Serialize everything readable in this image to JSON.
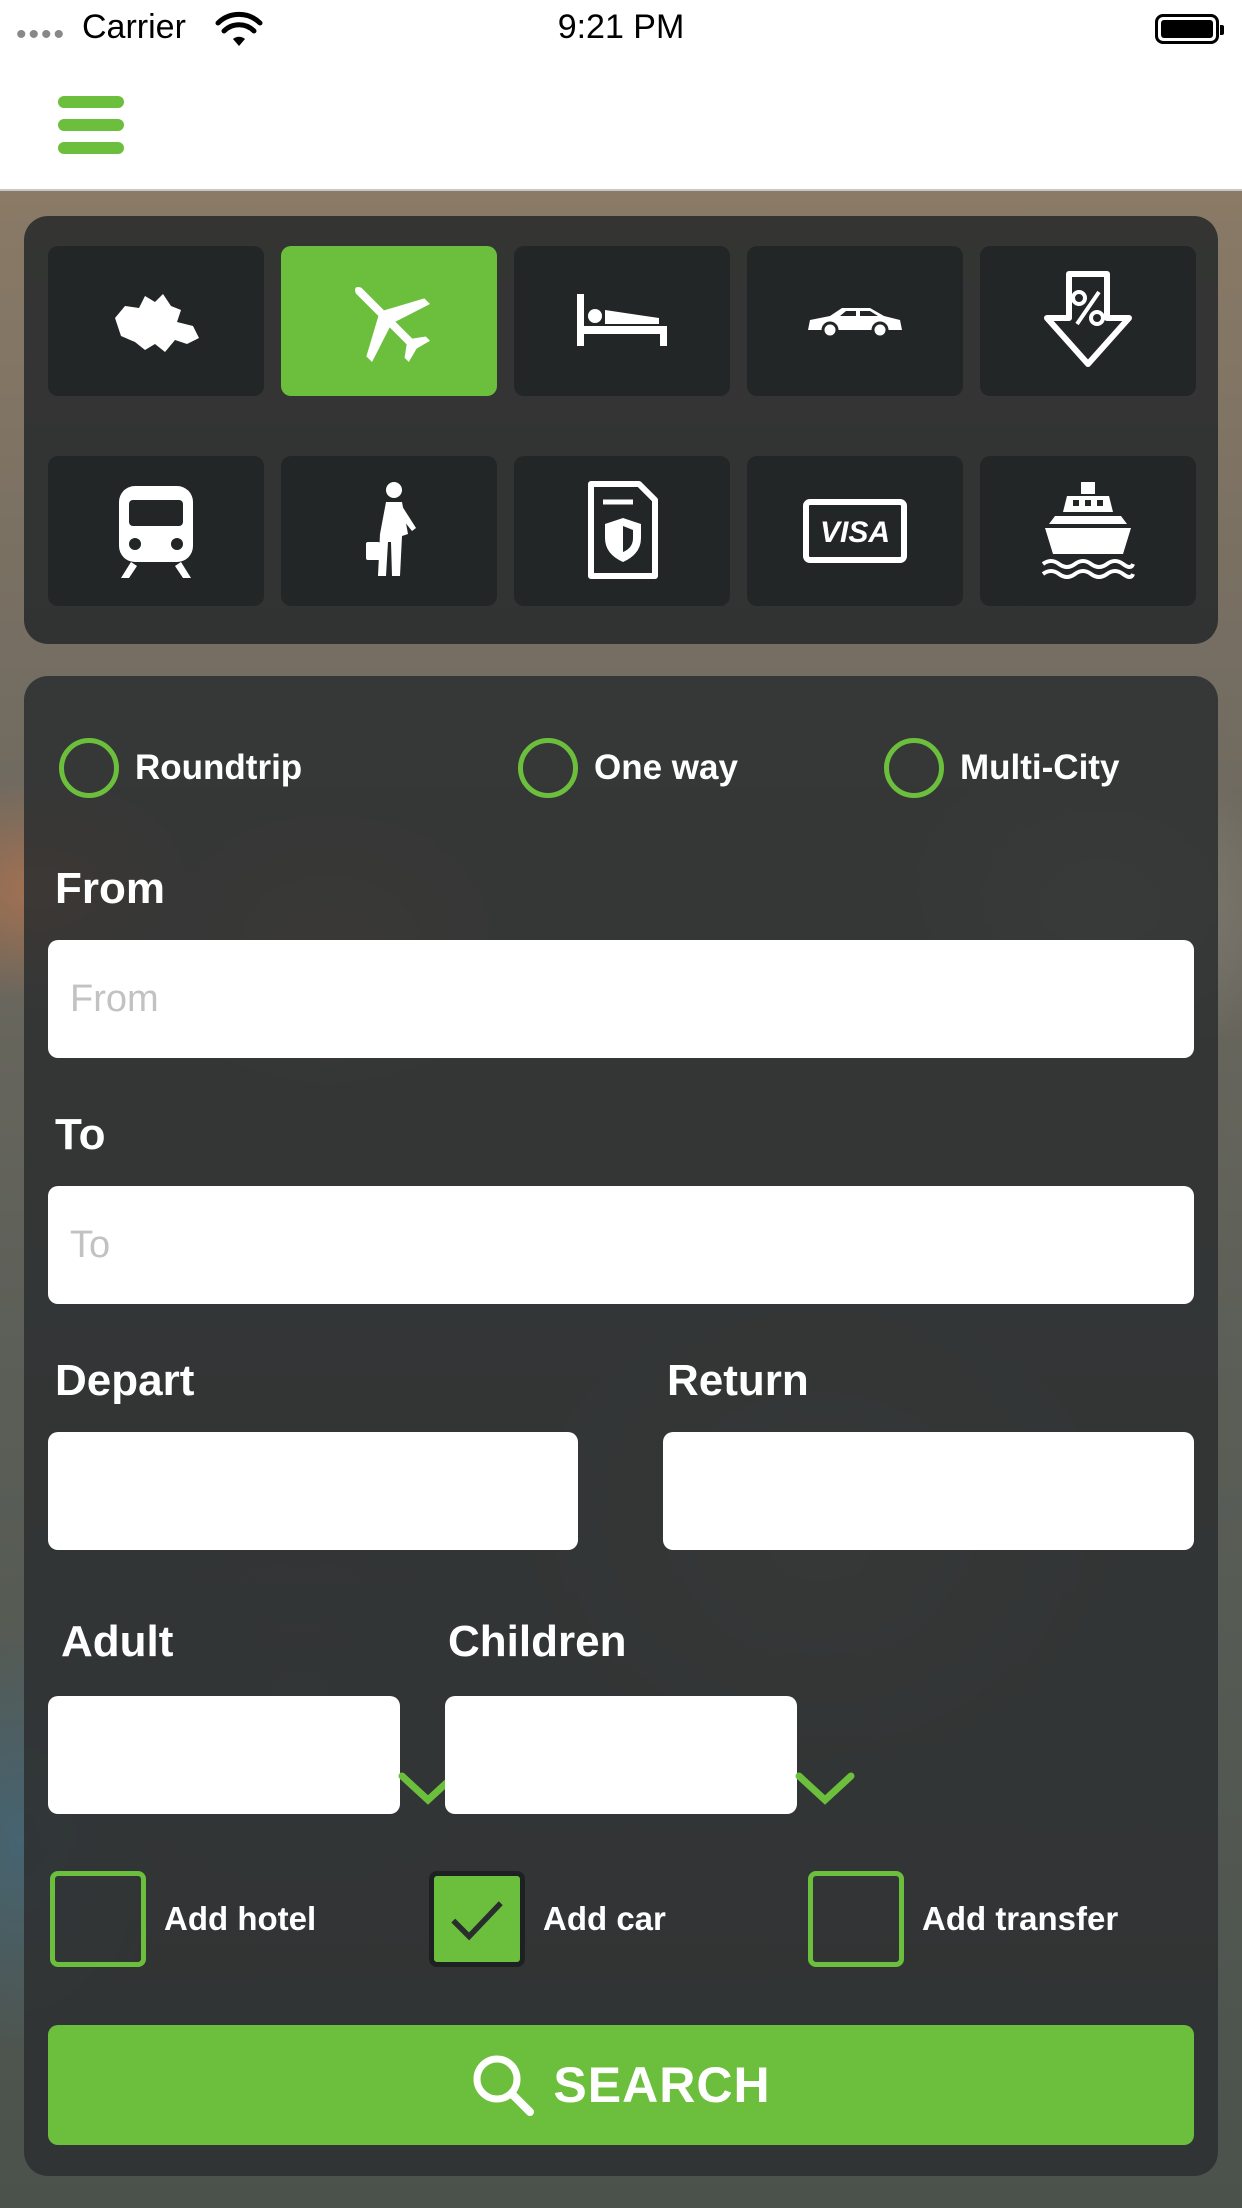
{
  "status_bar": {
    "carrier": "Carrier",
    "time": "9:21 PM",
    "signal": "••••"
  },
  "colors": {
    "accent": "#6cbf3c",
    "panel": "#2d3031",
    "tile": "#232627"
  },
  "services": [
    {
      "icon": "azerbaijan-map-icon",
      "active": false
    },
    {
      "icon": "airplane-icon",
      "active": true
    },
    {
      "icon": "bed-icon",
      "active": false
    },
    {
      "icon": "car-icon",
      "active": false
    },
    {
      "icon": "discount-icon",
      "active": false
    },
    {
      "icon": "train-icon",
      "active": false
    },
    {
      "icon": "traveler-icon",
      "active": false
    },
    {
      "icon": "insurance-icon",
      "active": false
    },
    {
      "icon": "visa-icon",
      "active": false
    },
    {
      "icon": "ship-icon",
      "active": false
    }
  ],
  "visa_text": "VISA",
  "trip_types": [
    {
      "label": "Roundtrip",
      "selected": false
    },
    {
      "label": "One way",
      "selected": false
    },
    {
      "label": "Multi-City",
      "selected": false
    }
  ],
  "from": {
    "label": "From",
    "placeholder": "From",
    "value": ""
  },
  "to": {
    "label": "To",
    "placeholder": "To",
    "value": ""
  },
  "depart": {
    "label": "Depart",
    "value": ""
  },
  "return": {
    "label": "Return",
    "value": ""
  },
  "adult": {
    "label": "Adult",
    "value": ""
  },
  "children": {
    "label": "Children",
    "value": ""
  },
  "extras": [
    {
      "label": "Add hotel",
      "checked": false
    },
    {
      "label": "Add car",
      "checked": true
    },
    {
      "label": "Add transfer",
      "checked": false
    }
  ],
  "search_label": "SEARCH"
}
